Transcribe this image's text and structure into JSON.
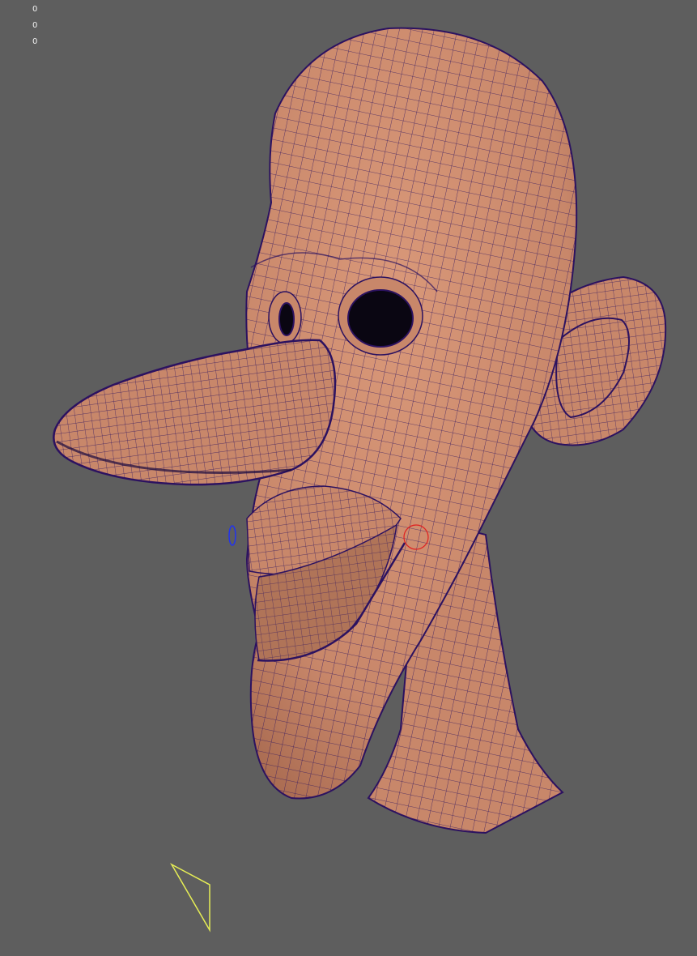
{
  "viewport": {
    "hud_values": [
      "0",
      "0",
      "0"
    ],
    "background_color": "#5e5e5e"
  },
  "scene": {
    "model": "cartoon-head-mesh",
    "skin_color": "#c8876a",
    "wire_color": "#2c1260",
    "cavity_color": "#0a0612",
    "selection_ring_color": "#e02020",
    "pivot_marker_color": "#2233ee",
    "locator_color": "#e6ee55"
  }
}
